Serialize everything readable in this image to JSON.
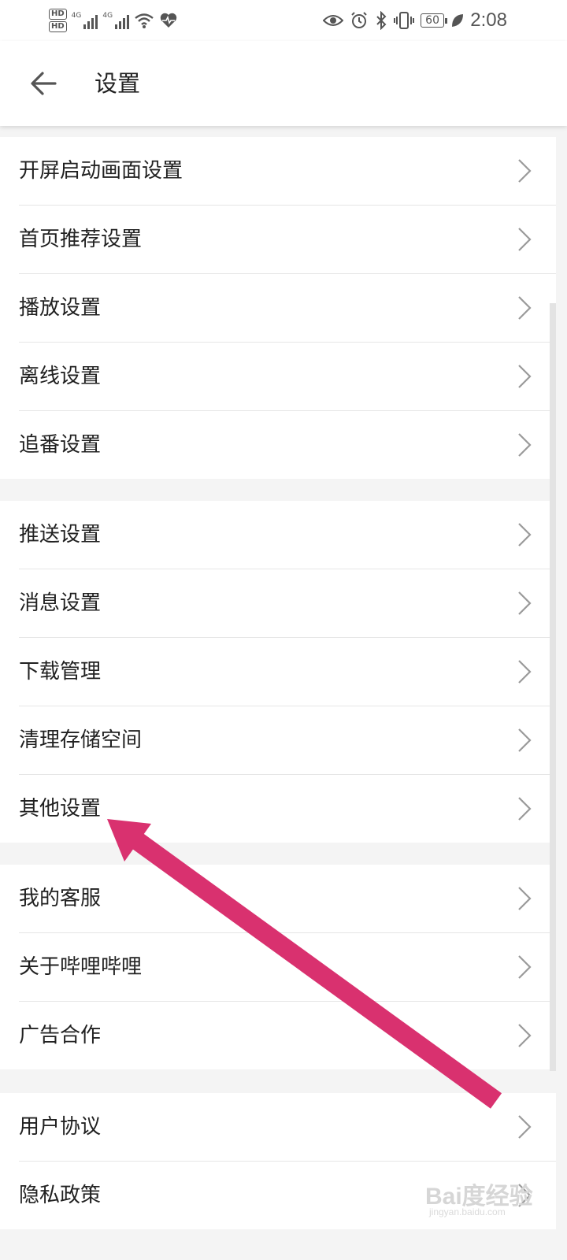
{
  "status_bar": {
    "hd1": "HD",
    "hd2": "HD",
    "net1": "4G",
    "net2": "4G",
    "battery": "60",
    "time": "2:08",
    "icons": [
      "wifi-icon",
      "health-heart-icon",
      "eye-icon",
      "alarm-icon",
      "bluetooth-icon",
      "vibrate-icon",
      "battery-icon",
      "leaf-icon"
    ]
  },
  "header": {
    "title": "设置"
  },
  "sections": [
    {
      "items": [
        "开屏启动画面设置",
        "首页推荐设置",
        "播放设置",
        "离线设置",
        "追番设置"
      ]
    },
    {
      "items": [
        "推送设置",
        "消息设置",
        "下载管理",
        "清理存储空间",
        "其他设置"
      ]
    },
    {
      "items": [
        "我的客服",
        "关于哔哩哔哩",
        "广告合作"
      ]
    },
    {
      "items": [
        "用户协议",
        "隐私政策"
      ]
    }
  ],
  "annotation": {
    "color": "#d9316f",
    "points_to": "其他设置"
  },
  "watermark": {
    "text": "Bai度经验",
    "sub": "jingyan.baidu.com"
  }
}
